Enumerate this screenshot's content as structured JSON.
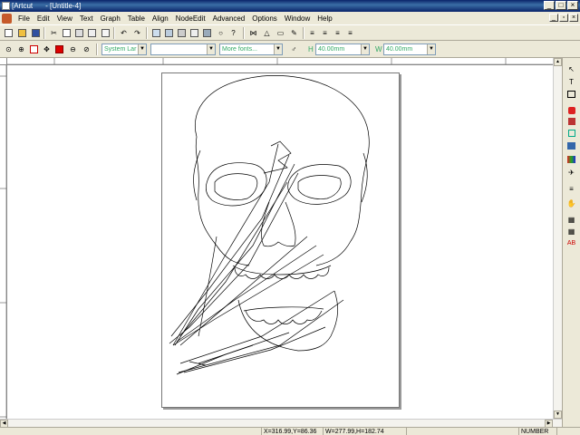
{
  "window": {
    "app_name": "[Artcut",
    "doc_name": "- [Untitle-4]"
  },
  "menu": [
    "File",
    "Edit",
    "View",
    "Text",
    "Graph",
    "Table",
    "Align",
    "NodeEdit",
    "Advanced",
    "Options",
    "Window",
    "Help"
  ],
  "toolbar2": {
    "font_combo": "System Lar",
    "style_combo": "",
    "more_fonts": "More fonts...",
    "height_label": "H",
    "height_value": "40.00mm",
    "width_label": "W",
    "width_value": "40.00mm"
  },
  "status": {
    "cursor": "X=316.99,Y=86.36",
    "size": "W=277.99,H=182.74",
    "mode": "NUMBER"
  },
  "icons": {
    "toolbar1": [
      "new-icon",
      "open-icon",
      "save-icon",
      "cut-icon",
      "copy-icon",
      "paste-icon",
      "undo-icon",
      "redo-icon",
      "page-icon",
      "print-icon",
      "preview-icon",
      "bulb-icon",
      "help-icon",
      "grid-icon",
      "align-icon",
      "edit-icon",
      "left-align-icon",
      "center-align-icon",
      "right-align-icon",
      "justify-icon"
    ],
    "toolbar2": [
      "zoom-icon",
      "zoom-in-icon",
      "zoom-select-icon",
      "pan-icon",
      "color-icon",
      "zoom-out-icon",
      "zoom-fit-icon"
    ],
    "toolbox": [
      "pointer-icon",
      "text-tool-icon",
      "node-tool-icon",
      "fill-icon",
      "bucket-icon",
      "shape-icon",
      "table-icon",
      "palette-icon",
      "cut-plot-icon",
      "doc-icon",
      "hand-icon",
      "layer-icon",
      "layer2-icon",
      "spell-icon"
    ]
  },
  "colors": {
    "titlebar": "#0a246a",
    "chrome": "#ece9d8",
    "canvas": "#ffffff"
  }
}
